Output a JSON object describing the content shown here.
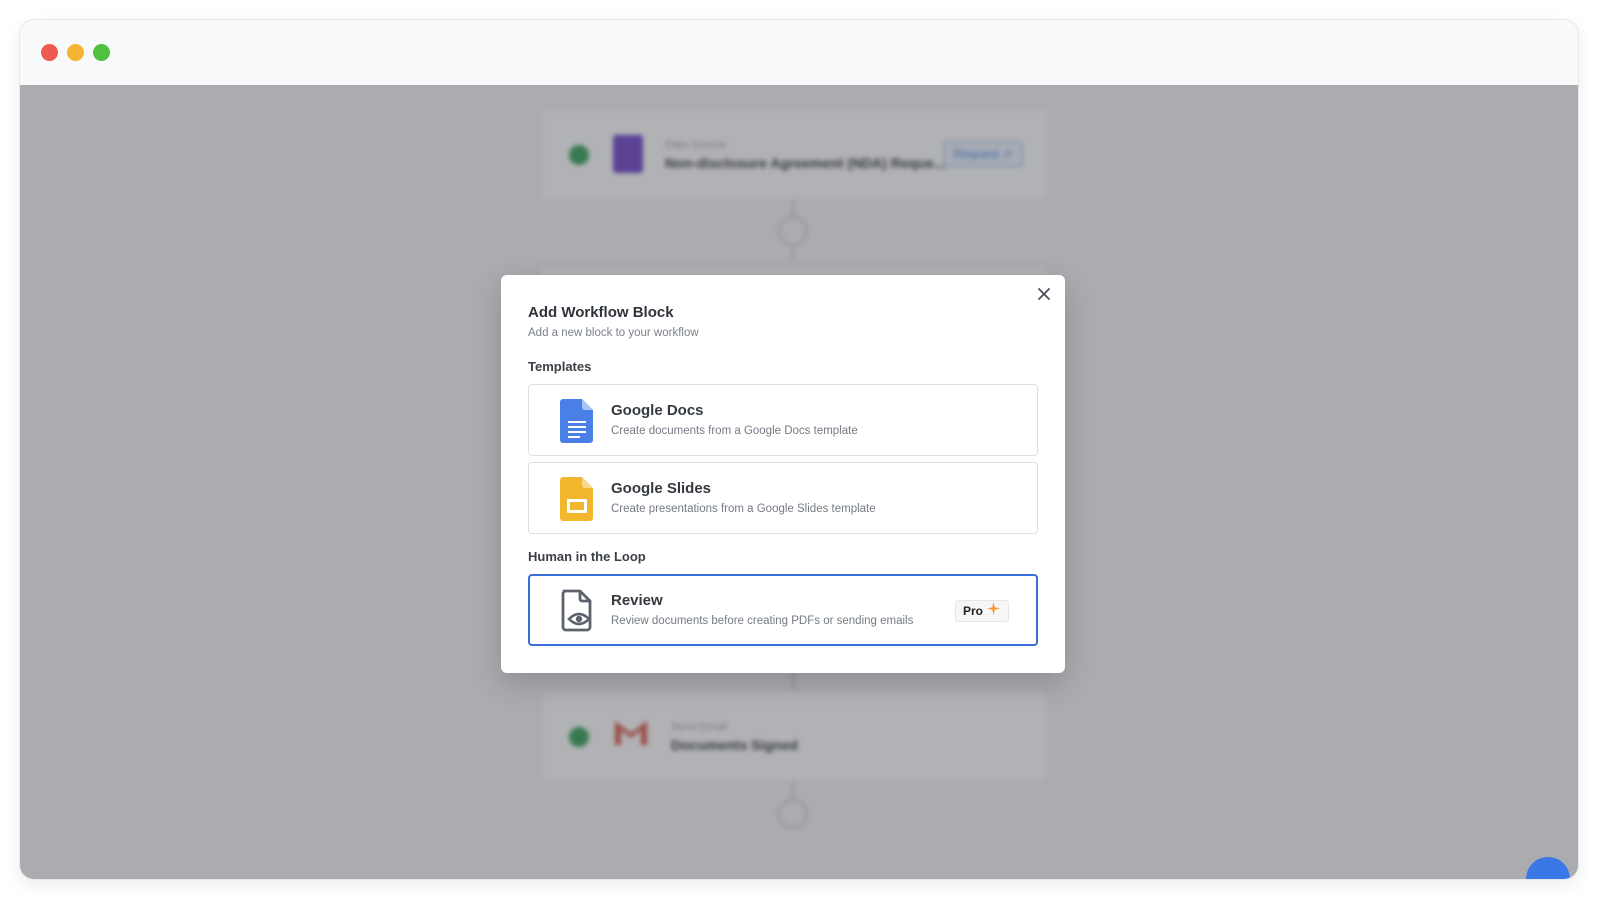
{
  "window": {
    "controls": [
      "close",
      "minimize",
      "maximize"
    ]
  },
  "background": {
    "cards": [
      {
        "label": "Data Source",
        "name": "Non-disclosure Agreement (NDA) Reque...",
        "action": "Request ↗",
        "icon": "form-icon"
      },
      {
        "label": "Send Email",
        "name": "Documents Signed",
        "icon": "gmail-icon"
      }
    ]
  },
  "modal": {
    "title": "Add Workflow Block",
    "subtitle": "Add a new block to your workflow",
    "sections": {
      "templates": "Templates",
      "human_in_loop": "Human in the Loop"
    },
    "options": {
      "google_docs": {
        "title": "Google Docs",
        "description": "Create documents from a Google Docs template",
        "icon": "google-docs-icon"
      },
      "google_slides": {
        "title": "Google Slides",
        "description": "Create presentations from a Google Slides template",
        "icon": "google-slides-icon"
      },
      "review": {
        "title": "Review",
        "description": "Review documents before creating PDFs or sending emails",
        "icon": "review-document-icon",
        "badge": "Pro"
      }
    }
  },
  "colors": {
    "accent": "#3a6fd8",
    "docs_blue": "#4a7fe8",
    "slides_yellow": "#f3b72e",
    "pro_spark": "#f59e33"
  }
}
